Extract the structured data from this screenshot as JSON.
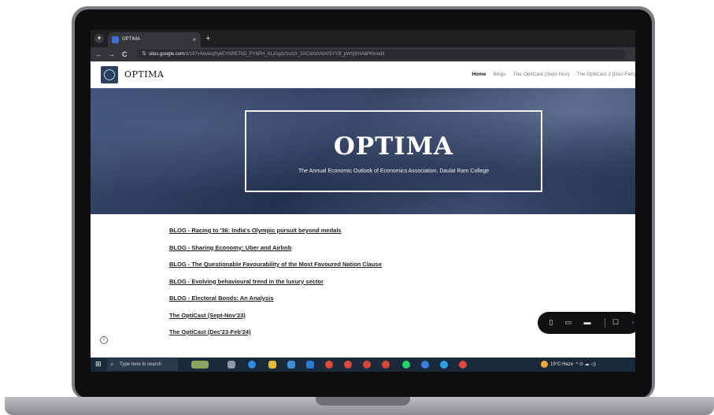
{
  "browser": {
    "tab_title": "OPTIMA",
    "tab_close": "×",
    "new_tab": "+",
    "back": "←",
    "forward": "→",
    "reload": "C",
    "url_host": "sites.google.com",
    "url_path": "/d/197vA6vleqSykEYNREToD_PY6PH_KLjGg/p/1crUr_3ACdXdVidXiSYYB_pW0jSHA6PKk/edit"
  },
  "site": {
    "brand": "OPTIMA",
    "nav": [
      "Home",
      "Blogs",
      "The OptiCast (Sept-Nov)",
      "The OptiCast 2 (Dec-Feb)"
    ],
    "hero_title": "OPTIMA",
    "hero_subtitle": "The Annual Economic Outlook of Economics Association, Daulat Ram College",
    "links": [
      "BLOG - Racing to '36:  India's Olympic pursuit beyond medals",
      "BLOG - Sharing Economy: Uber and Airbnb",
      "BLOG - The Questionable Favourability of the Most Favoured Nation Clause",
      "BLOG - Evolving behavioural trend in the luxury sector",
      "BLOG - Electoral Bonds: An Analysis",
      "The OptiCast (Sept-Nov'23)",
      "The OptiCast (Dec'23-Feb'24)"
    ],
    "info_icon": "i"
  },
  "preview_toolbar": {
    "icons": [
      "phone-icon",
      "tablet-icon",
      "laptop-icon",
      "comment-icon",
      "chevron-right-icon"
    ]
  },
  "taskbar": {
    "search_placeholder": "Type here to search",
    "weather": "19°C  Haze",
    "tray_symbols": "^ ⊙ ☁ ◁)"
  },
  "colors": {
    "hero_base": "#2d3c5c",
    "chrome_dark": "#1f1f22",
    "taskbar": "#1b2a3a"
  }
}
